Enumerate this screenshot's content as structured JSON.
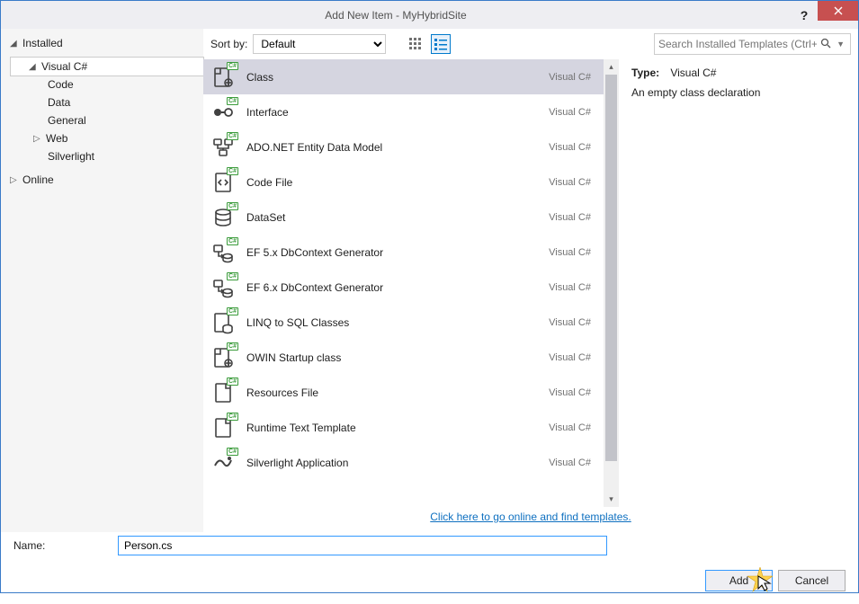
{
  "title": "Add New Item - MyHybridSite",
  "tree": {
    "installed": "Installed",
    "visual_csharp": "Visual C#",
    "children": [
      "Code",
      "Data",
      "General",
      "Web",
      "Silverlight"
    ],
    "online": "Online"
  },
  "toolbar": {
    "sort_label": "Sort by:",
    "sort_value": "Default",
    "search_placeholder": "Search Installed Templates (Ctrl+E)"
  },
  "templates": [
    {
      "name": "Class",
      "lang": "Visual C#",
      "selected": true,
      "icon": "class"
    },
    {
      "name": "Interface",
      "lang": "Visual C#",
      "icon": "interface"
    },
    {
      "name": "ADO.NET Entity Data Model",
      "lang": "Visual C#",
      "icon": "entity"
    },
    {
      "name": "Code File",
      "lang": "Visual C#",
      "icon": "codefile"
    },
    {
      "name": "DataSet",
      "lang": "Visual C#",
      "icon": "dataset"
    },
    {
      "name": "EF 5.x DbContext Generator",
      "lang": "Visual C#",
      "icon": "ef"
    },
    {
      "name": "EF 6.x DbContext Generator",
      "lang": "Visual C#",
      "icon": "ef"
    },
    {
      "name": "LINQ to SQL Classes",
      "lang": "Visual C#",
      "icon": "linq"
    },
    {
      "name": "OWIN Startup class",
      "lang": "Visual C#",
      "icon": "class"
    },
    {
      "name": "Resources File",
      "lang": "Visual C#",
      "icon": "resx"
    },
    {
      "name": "Runtime Text Template",
      "lang": "Visual C#",
      "icon": "resx"
    },
    {
      "name": "Silverlight Application",
      "lang": "Visual C#",
      "icon": "silverlight"
    }
  ],
  "details": {
    "type_label": "Type:",
    "type_value": "Visual C#",
    "description": "An empty class declaration"
  },
  "online_link": "Click here to go online and find templates.",
  "footer": {
    "name_label": "Name:",
    "name_value": "Person.cs",
    "add": "Add",
    "cancel": "Cancel"
  }
}
